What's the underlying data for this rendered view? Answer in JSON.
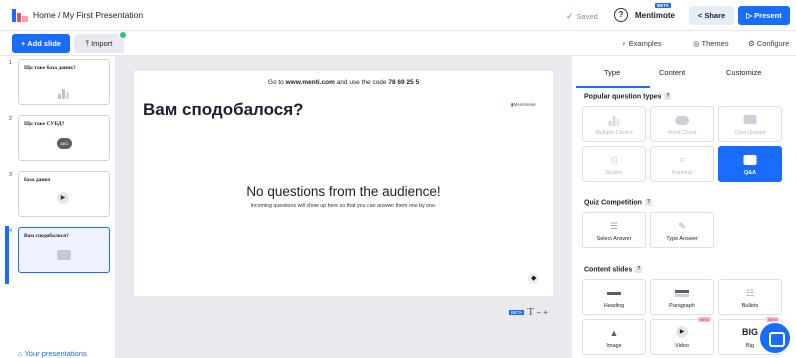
{
  "header": {
    "breadcrumb": "Home / My First Presentation",
    "saved_label": "Saved",
    "help_icon": "?",
    "mentimote_label": "Mentimote",
    "mentimote_badge": "BETA",
    "share_label": "Share",
    "present_label": "Present"
  },
  "toolbar": {
    "add_slide_label": "+ Add slide",
    "import_label": "Import",
    "examples_label": "Examples",
    "themes_label": "Themes",
    "configure_label": "Configure"
  },
  "slides": [
    {
      "num": "1",
      "title": "Що таке база даних?",
      "kind": "bar-chart"
    },
    {
      "num": "2",
      "title": "Що таке СУБД?",
      "kind": "word-cloud"
    },
    {
      "num": "3",
      "title": "база даних",
      "kind": "video"
    },
    {
      "num": "4",
      "title": "Вам сподобалося?",
      "kind": "qa",
      "active": true
    }
  ],
  "your_presentations_label": "Your presentations",
  "slide": {
    "code_line_prefix": "Go to ",
    "code_line_url": "www.menti.com",
    "code_line_mid": " and use the code ",
    "code_value": "78 69 25 5",
    "title": "Вам сподобалося?",
    "brand": "Mentimeter",
    "empty_title": "No questions from the audience!",
    "empty_subtitle": "Incoming questions will show up here so that you can answer them one by one."
  },
  "zoom": {
    "badge": "BETA",
    "font_icon": "T",
    "controls": "− +"
  },
  "panel": {
    "tabs": [
      "Type",
      "Content",
      "Customize"
    ],
    "active_tab": "Type",
    "popular_title": "Popular question types",
    "popular": [
      {
        "label": "Multiple Choice",
        "icon": "bar-chart-icon",
        "dim": true
      },
      {
        "label": "Word Cloud",
        "icon": "word-cloud-icon",
        "dim": true
      },
      {
        "label": "Open Ended",
        "icon": "speech-bubbles-icon",
        "dim": true
      },
      {
        "label": "Scales",
        "icon": "scales-icon",
        "dim": true
      },
      {
        "label": "Ranking",
        "icon": "ranking-icon",
        "dim": true
      },
      {
        "label": "Q&A",
        "icon": "qa-bubble-icon",
        "selected": true
      }
    ],
    "quiz_title": "Quiz Competition",
    "quiz": [
      {
        "label": "Select Answer",
        "icon": "list-icon"
      },
      {
        "label": "Type Answer",
        "icon": "pencil-icon"
      }
    ],
    "content_title": "Content slides",
    "content": [
      {
        "label": "Heading",
        "icon": "heading-icon"
      },
      {
        "label": "Paragraph",
        "icon": "paragraph-icon"
      },
      {
        "label": "Bullets",
        "icon": "bullets-icon"
      },
      {
        "label": "Image",
        "icon": "image-icon"
      },
      {
        "label": "Video",
        "icon": "play-icon",
        "badge": "NEW"
      },
      {
        "label": "Big",
        "icon": "big-text-icon",
        "icon_text": "BIG",
        "badge": "NEW"
      }
    ]
  }
}
